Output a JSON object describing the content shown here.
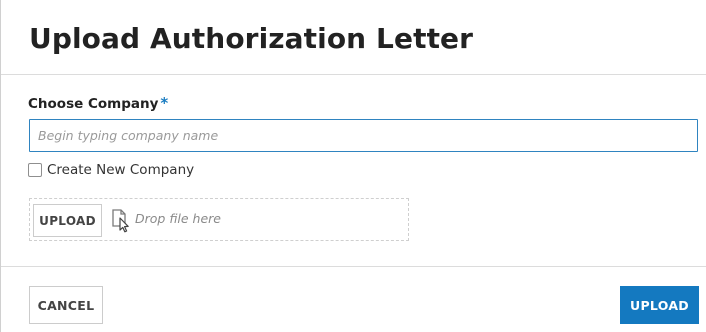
{
  "dialog": {
    "title": "Upload Authorization Letter"
  },
  "form": {
    "company_label": "Choose Company",
    "required_marker": "*",
    "company_input_placeholder": "Begin typing company name",
    "company_input_value": "",
    "create_new_label": "Create New Company",
    "create_new_checked": false
  },
  "dropzone": {
    "upload_button_label": "UPLOAD",
    "drop_text": "Drop file here",
    "icon": "file-pointer-icon"
  },
  "footer": {
    "cancel_label": "CANCEL",
    "upload_label": "UPLOAD"
  },
  "colors": {
    "accent": "#1479c0",
    "input_border": "#2f84c0",
    "required": "#1a7cc1"
  }
}
